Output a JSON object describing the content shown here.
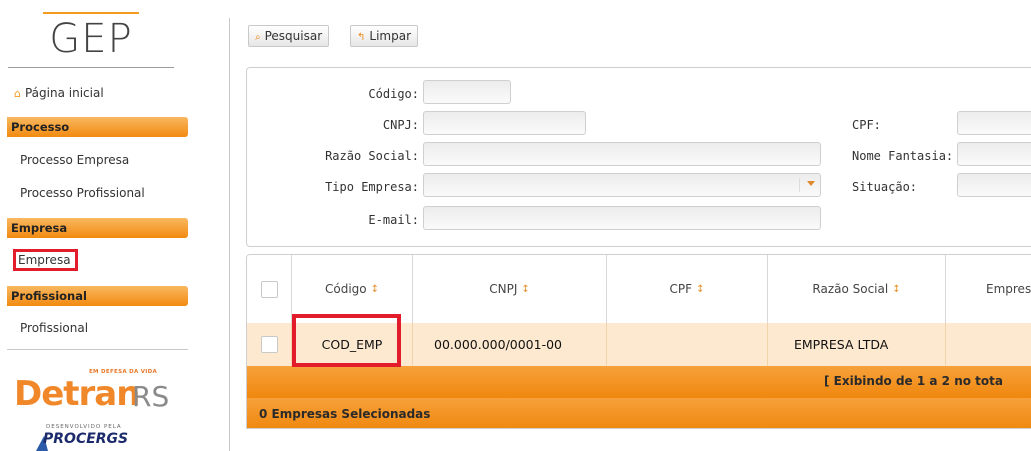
{
  "sidebar": {
    "logo": "GEP",
    "home": "Página inicial",
    "sections": [
      {
        "title": "Processo",
        "items": [
          "Processo Empresa",
          "Processo Profissional"
        ]
      },
      {
        "title": "Empresa",
        "items": [
          "Empresa"
        ]
      },
      {
        "title": "Profissional",
        "items": [
          "Profissional"
        ]
      }
    ],
    "detran": {
      "tagline": "EM DEFESA DA VIDA",
      "word": "Detran",
      "suffix": "RS"
    },
    "developer": {
      "label": "DESENVOLVIDO PELA",
      "name": "PROCERGS"
    }
  },
  "toolbar": {
    "search_label": "Pesquisar",
    "clear_label": "Limpar"
  },
  "filters": {
    "codigo": {
      "label": "Código:",
      "value": ""
    },
    "cnpj": {
      "label": "CNPJ:",
      "value": ""
    },
    "cpf": {
      "label": "CPF:",
      "value": ""
    },
    "razao_social": {
      "label": "Razão Social:",
      "value": ""
    },
    "nome_fantasia": {
      "label": "Nome Fantasia:",
      "value": ""
    },
    "tipo_empresa": {
      "label": "Tipo Empresa:",
      "value": ""
    },
    "situacao": {
      "label": "Situação:",
      "value": ""
    },
    "email": {
      "label": "E-mail:",
      "value": ""
    }
  },
  "grid": {
    "columns": [
      "Código",
      "CNPJ",
      "CPF",
      "Razão Social",
      "Empresa"
    ],
    "rows": [
      {
        "codigo": "COD_EMP",
        "cnpj": "00.000.000/0001-00",
        "cpf": "",
        "razao_social": "EMPRESA LTDA",
        "empresa": ""
      }
    ],
    "footer": "[ Exibindo de 1 a 2 no tota",
    "selected": "0 Empresas Selecionadas"
  },
  "colors": {
    "accent": "#f39a1f",
    "highlight_border": "#e21c2a",
    "row_bg": "#fde9cf"
  }
}
